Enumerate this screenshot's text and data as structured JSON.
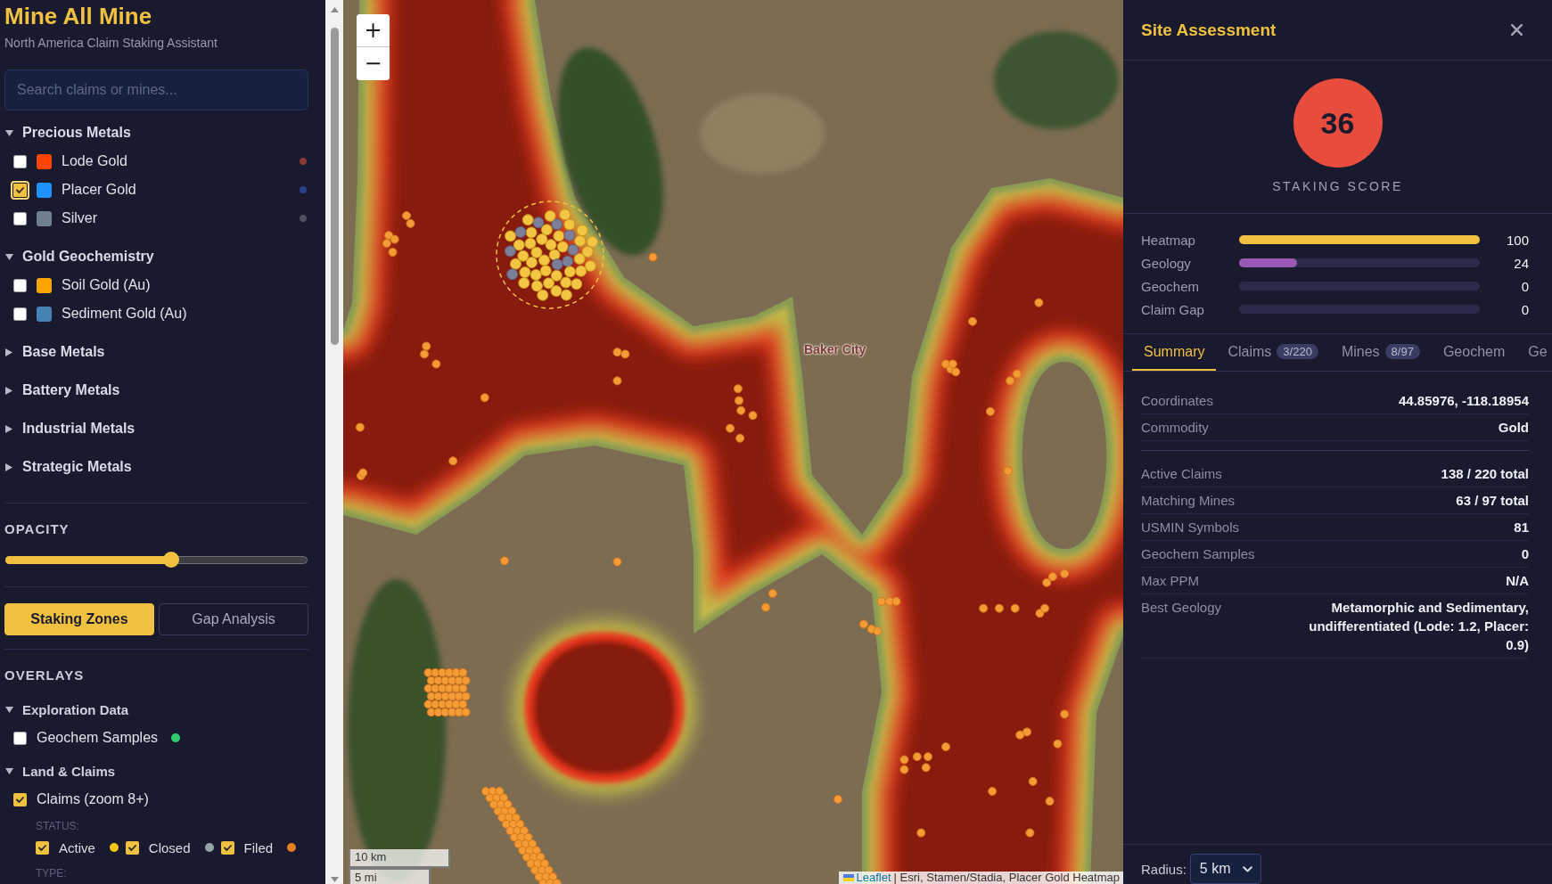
{
  "sidebar": {
    "title": "Mine All Mine",
    "subtitle": "North America Claim Staking Assistant",
    "search": {
      "placeholder": "Search claims or mines..."
    },
    "commodity_groups": [
      {
        "label": "Precious Metals",
        "expanded": true,
        "items": [
          {
            "label": "Lode Gold",
            "checked": false,
            "focused": false,
            "color": "#ff4500",
            "dot": {
              "color": "#8b3a36"
            }
          },
          {
            "label": "Placer Gold",
            "checked": true,
            "focused": true,
            "color": "#1e90ff",
            "dot": {
              "color": "#2b3f8c"
            }
          },
          {
            "label": "Silver",
            "checked": false,
            "focused": false,
            "color": "#708090",
            "dot": {
              "color": "#4f5062"
            }
          }
        ]
      },
      {
        "label": "Gold Geochemistry",
        "expanded": true,
        "items": [
          {
            "label": "Soil Gold (Au)",
            "checked": false,
            "focused": false,
            "color": "#ffa500"
          },
          {
            "label": "Sediment Gold (Au)",
            "checked": false,
            "focused": false,
            "color": "#4682b4"
          }
        ]
      },
      {
        "label": "Base Metals",
        "expanded": false
      },
      {
        "label": "Battery Metals",
        "expanded": false
      },
      {
        "label": "Industrial Metals",
        "expanded": false
      },
      {
        "label": "Strategic Metals",
        "expanded": false
      }
    ],
    "opacity": {
      "label": "OPACITY",
      "level": 0.55
    },
    "modes": [
      {
        "label": "Staking Zones",
        "selected": true
      },
      {
        "label": "Gap Analysis",
        "selected": false
      }
    ],
    "overlays": {
      "heading": "OVERLAYS",
      "groups": [
        {
          "label": "Exploration Data",
          "expanded": true,
          "items": [
            {
              "label": "Geochem Samples",
              "checked": false,
              "color": "#2ecc71"
            }
          ]
        },
        {
          "label": "Land & Claims",
          "expanded": true,
          "items": [
            {
              "label": "Claims (zoom 8+)",
              "checked": true
            }
          ],
          "status_heading": "STATUS:",
          "statuses": [
            {
              "label": "Active",
              "checked": true,
              "color": "#f1c40f"
            },
            {
              "label": "Closed",
              "checked": true,
              "color": "#95a5a6"
            },
            {
              "label": "Filed",
              "checked": true,
              "color": "#e67e22"
            }
          ],
          "type_heading": "TYPE:"
        }
      ]
    }
  },
  "map": {
    "zoom_controls": [
      "+",
      "−"
    ],
    "place_label": "Baker City",
    "scale": [
      "10 km",
      "5 mi"
    ],
    "attribution": {
      "link": "Leaflet",
      "text": "| Esri, Stamen/Stadia, Placer Gold Heatmap"
    }
  },
  "assessment": {
    "title": "Site Assessment",
    "score": {
      "value": "36",
      "label": "STAKING SCORE"
    },
    "factors": [
      {
        "label": "Heatmap",
        "level": 1,
        "value": "100",
        "color": "#f0c040"
      },
      {
        "label": "Geology",
        "level": 0.24,
        "value": "24",
        "color": "#9b59b6"
      },
      {
        "label": "Geochem",
        "value": "0"
      },
      {
        "label": "Claim Gap",
        "value": "0"
      }
    ],
    "tabs": [
      {
        "label": "Summary",
        "selected": true
      },
      {
        "label": "Claims",
        "badge": "3/220",
        "selected": false
      },
      {
        "label": "Mines",
        "badge": "8/97",
        "selected": false
      },
      {
        "label": "Geochem",
        "selected": false
      },
      {
        "label": "Ge",
        "selected": false
      }
    ],
    "summary": {
      "sections": [
        {
          "rows": [
            {
              "label": "Coordinates",
              "value": "44.85976, -118.18954"
            },
            {
              "label": "Commodity",
              "value": "Gold"
            }
          ]
        },
        {
          "rows": [
            {
              "label": "Active Claims",
              "value": "138 / 220 total"
            },
            {
              "label": "Matching Mines",
              "value": "63 / 97 total"
            },
            {
              "label": "USMIN Symbols",
              "value": "81"
            },
            {
              "label": "Geochem Samples",
              "value": "0"
            },
            {
              "label": "Max PPM",
              "value": "N/A"
            },
            {
              "label": "Best Geology",
              "value": "Metamorphic and Sedimentary, undifferentiated (Lode: 1.2, Placer: 0.9)"
            }
          ]
        }
      ]
    },
    "footer": {
      "label": "Radius:",
      "select_value": "5 km"
    }
  }
}
